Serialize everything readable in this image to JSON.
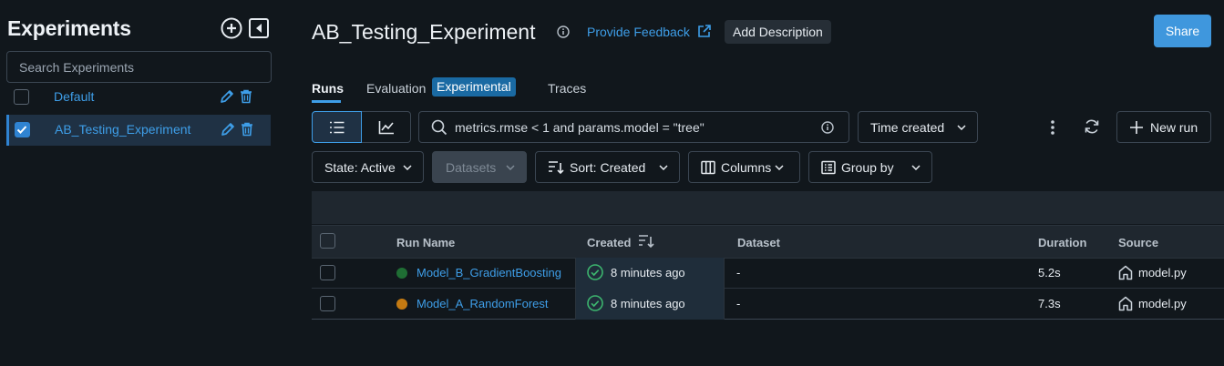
{
  "sidebar": {
    "title": "Experiments",
    "search_placeholder": "Search Experiments",
    "experiments": [
      {
        "name": "Default",
        "checked": false
      },
      {
        "name": "AB_Testing_Experiment",
        "checked": true
      }
    ]
  },
  "header": {
    "title": "AB_Testing_Experiment",
    "feedback_label": "Provide Feedback",
    "add_description_label": "Add Description",
    "share_label": "Share"
  },
  "tabs": {
    "runs": "Runs",
    "evaluation": "Evaluation",
    "experimental_badge": "Experimental",
    "traces": "Traces"
  },
  "toolbar": {
    "search_value": "metrics.rmse < 1 and params.model = \"tree\"",
    "time_created_label": "Time created",
    "new_run_label": "New run",
    "state_label": "State: Active",
    "datasets_label": "Datasets",
    "sort_label": "Sort: Created",
    "columns_label": "Columns",
    "group_by_label": "Group by"
  },
  "table": {
    "headers": {
      "run_name": "Run Name",
      "created": "Created",
      "dataset": "Dataset",
      "duration": "Duration",
      "source": "Source"
    },
    "rows": [
      {
        "run_name": "Model_B_GradientBoosting",
        "color": "#1f6e34",
        "created": "8 minutes ago",
        "dataset": "-",
        "duration": "5.2s",
        "source": "model.py"
      },
      {
        "run_name": "Model_A_RandomForest",
        "color": "#c47a12",
        "created": "8 minutes ago",
        "dataset": "-",
        "duration": "7.3s",
        "source": "model.py"
      }
    ]
  }
}
